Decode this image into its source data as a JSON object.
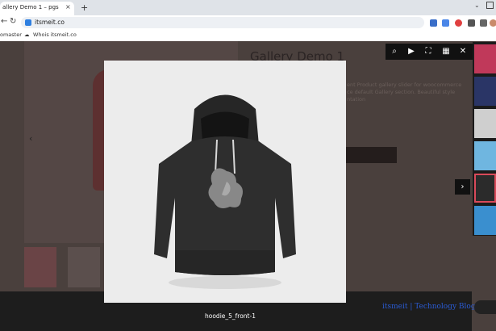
{
  "browser": {
    "tab_title": "allery Demo 1 – pgs",
    "tab_close": "×",
    "new_tab": "+",
    "window_min": "⌄",
    "url": "itsmeit.co",
    "nav_back": "←",
    "nav_forward": "→",
    "reload": "↻",
    "bookmarks": [
      {
        "label": "omaster"
      },
      {
        "label": "Whois itsmeit.co"
      }
    ]
  },
  "page": {
    "title": "Gallery Demo 1",
    "description": "ent Product gallery slider for woocommerce ce default Gallery section. Beautiful style ntation",
    "prev_arrow": "‹"
  },
  "lightbox": {
    "toolbar_icons": [
      {
        "name": "search-icon",
        "glyph": "⌕"
      },
      {
        "name": "play-icon",
        "glyph": "▶"
      },
      {
        "name": "fullscreen-icon",
        "glyph": "⛶"
      },
      {
        "name": "grid-icon",
        "glyph": "▦"
      },
      {
        "name": "close-icon",
        "glyph": "✕"
      }
    ],
    "next_arrow": "›",
    "caption": "hoodie_5_front-1",
    "thumbnails": [
      {
        "color": "#c0395a"
      },
      {
        "color": "#2a3566"
      },
      {
        "color": "#cfcfcf"
      },
      {
        "color": "#6fb6e0"
      },
      {
        "color": "#2b2b2b",
        "active": true
      },
      {
        "color": "#3a8fcf"
      }
    ]
  },
  "watermark": "itsmeit | Technology Blogs",
  "colors": {
    "overlay": "#2a2a2a",
    "active_thumb_border": "#d94a5a",
    "watermark": "#2a5bd4"
  }
}
